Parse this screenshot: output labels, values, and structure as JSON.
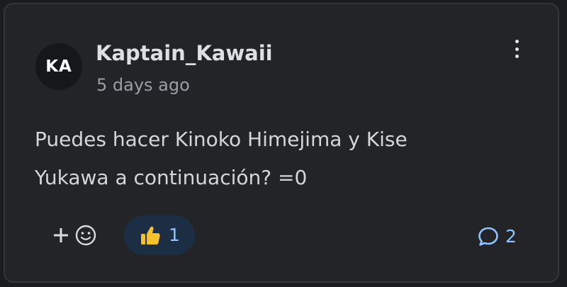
{
  "comment": {
    "avatar_initials": "KA",
    "username": "Kaptain_Kawaii",
    "timestamp": "5 days ago",
    "text_line1": "Puedes hacer Kinoko Himejima y Kise",
    "text_line2": "Yukawa a continuación? =0"
  },
  "reactions": {
    "like_count": "1",
    "reply_count": "2"
  },
  "icons": {
    "more": "more-vertical-icon",
    "add_reaction": "plus-icon",
    "emoji": "smiley-icon",
    "like": "thumbs-up-icon",
    "replies": "speech-bubble-icon"
  },
  "colors": {
    "background": "#1b1c1f",
    "card": "#232427",
    "accent_text": "#8fc4ff",
    "like_pill": "#1c2e44",
    "thumb": "#f6c12b"
  }
}
